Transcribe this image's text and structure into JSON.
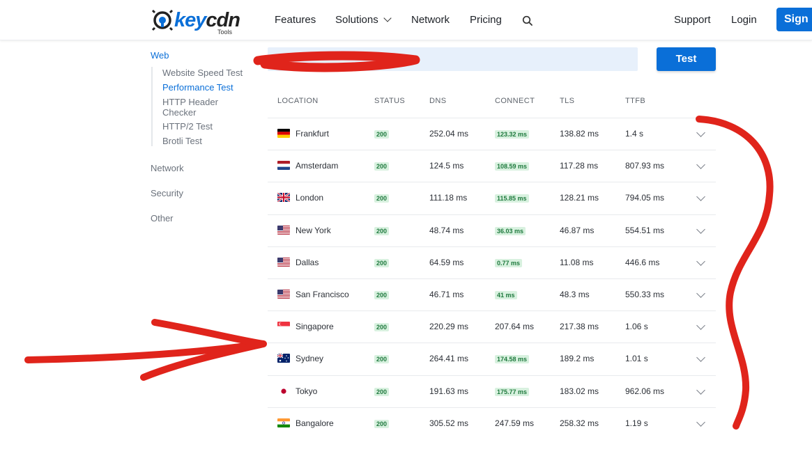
{
  "header": {
    "logo_text_key": "key",
    "logo_text_cdn": "cdn",
    "logo_sub": "Tools",
    "nav": [
      "Features",
      "Solutions",
      "Network",
      "Pricing"
    ],
    "support": "Support",
    "login": "Login",
    "signup": "Sign up"
  },
  "sidebar": {
    "web": "Web",
    "web_items": [
      "Website Speed Test",
      "Performance Test",
      "HTTP Header Checker",
      "HTTP/2 Test",
      "Brotli Test"
    ],
    "active_item": "Performance Test",
    "sections": [
      "Network",
      "Security",
      "Other"
    ]
  },
  "test": {
    "url_value": "",
    "button": "Test"
  },
  "table": {
    "columns": [
      "LOCATION",
      "STATUS",
      "DNS",
      "CONNECT",
      "TLS",
      "TTFB"
    ],
    "rows": [
      {
        "flag": "de",
        "location": "Frankfurt",
        "status": "200",
        "dns": "252.04 ms",
        "connect": "123.32 ms",
        "connect_fast": true,
        "tls": "138.82 ms",
        "ttfb": "1.4 s"
      },
      {
        "flag": "nl",
        "location": "Amsterdam",
        "status": "200",
        "dns": "124.5 ms",
        "connect": "108.59 ms",
        "connect_fast": true,
        "tls": "117.28 ms",
        "ttfb": "807.93 ms"
      },
      {
        "flag": "gb",
        "location": "London",
        "status": "200",
        "dns": "111.18 ms",
        "connect": "115.85 ms",
        "connect_fast": true,
        "tls": "128.21 ms",
        "ttfb": "794.05 ms"
      },
      {
        "flag": "us",
        "location": "New York",
        "status": "200",
        "dns": "48.74 ms",
        "connect": "36.03 ms",
        "connect_fast": true,
        "tls": "46.87 ms",
        "ttfb": "554.51 ms"
      },
      {
        "flag": "us",
        "location": "Dallas",
        "status": "200",
        "dns": "64.59 ms",
        "connect": "0.77 ms",
        "connect_fast": true,
        "tls": "11.08 ms",
        "ttfb": "446.6 ms"
      },
      {
        "flag": "us",
        "location": "San Francisco",
        "status": "200",
        "dns": "46.71 ms",
        "connect": "41 ms",
        "connect_fast": true,
        "tls": "48.3 ms",
        "ttfb": "550.33 ms"
      },
      {
        "flag": "sg",
        "location": "Singapore",
        "status": "200",
        "dns": "220.29 ms",
        "connect": "207.64 ms",
        "connect_fast": false,
        "tls": "217.38 ms",
        "ttfb": "1.06 s"
      },
      {
        "flag": "au",
        "location": "Sydney",
        "status": "200",
        "dns": "264.41 ms",
        "connect": "174.58 ms",
        "connect_fast": true,
        "tls": "189.2 ms",
        "ttfb": "1.01 s"
      },
      {
        "flag": "jp",
        "location": "Tokyo",
        "status": "200",
        "dns": "191.63 ms",
        "connect": "175.77 ms",
        "connect_fast": true,
        "tls": "183.02 ms",
        "ttfb": "962.06 ms"
      },
      {
        "flag": "in",
        "location": "Bangalore",
        "status": "200",
        "dns": "305.52 ms",
        "connect": "247.59 ms",
        "connect_fast": false,
        "tls": "258.32 ms",
        "ttfb": "1.19 s"
      }
    ]
  },
  "colors": {
    "brand_blue": "#0a6fd8",
    "badge_bg": "#d8f1df",
    "badge_text": "#1f7a3e",
    "markup_red": "#e0241b"
  }
}
